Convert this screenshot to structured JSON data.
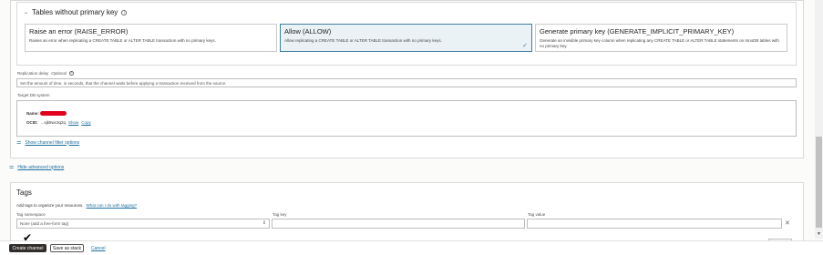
{
  "primary_key": {
    "section_title": "Tables without primary key",
    "options": [
      {
        "title": "Raise an error (RAISE_ERROR)",
        "desc": "Raises an error when replicating a CREATE TABLE or ALTER TABLE transaction with no primary keys.",
        "selected": false
      },
      {
        "title": "Allow (ALLOW)",
        "desc": "Allow replicating a CREATE TABLE or ALTER TABLE transaction with no primary keys.",
        "selected": true
      },
      {
        "title": "Generate primary key (GENERATE_IMPLICIT_PRIMARY_KEY)",
        "desc": "Generate an invisible primary key column when replicating any CREATE TABLE or ALTER TABLE statements on InnoDB tables with no primary key.",
        "selected": false
      }
    ]
  },
  "replication_delay": {
    "label": "Replication delay",
    "optional": "Optional",
    "placeholder": "Set the amount of time, in seconds, that the channel waits before applying a transaction received from the source."
  },
  "target": {
    "label": "Target DB system",
    "name_label": "Name:",
    "ocid_label": "OCID:",
    "ocid_value": "...sjk5wc3q2q",
    "show": "Show",
    "copy": "Copy"
  },
  "filter_link": "Show channel filter options",
  "advanced_link": "Hide advanced options",
  "tags": {
    "title": "Tags",
    "help_text": "Add tags to organize your resources.",
    "help_link": "What can I do with tagging?",
    "namespace_label": "Tag namespace",
    "namespace_value": "None (add a free-form tag)",
    "key_label": "Tag key",
    "value_label": "Tag value"
  },
  "footer": {
    "create": "Create channel",
    "stack": "Save as stack",
    "cancel": "Cancel"
  },
  "colors": {
    "accent": "#3f7fa1",
    "primary_button": "#312d2a",
    "redaction": "#e0001b"
  }
}
